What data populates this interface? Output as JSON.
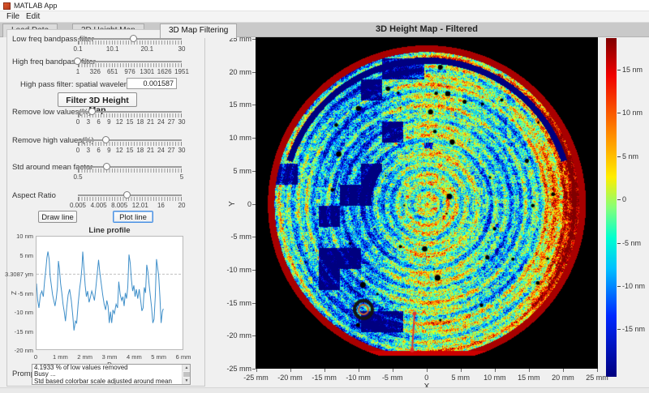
{
  "window": {
    "title": "MATLAB App",
    "menu": [
      "File",
      "Edit"
    ]
  },
  "tabs": [
    {
      "label": "Load Data",
      "active": false
    },
    {
      "label": "3D Height Map",
      "active": false
    },
    {
      "label": "3D Map Filtering",
      "active": true
    }
  ],
  "panel": {
    "sliders": [
      {
        "label": "Low freq bandpass filter",
        "ticks": [
          "0.1",
          "10.1",
          "20.1",
          "30"
        ],
        "percent": 54
      },
      {
        "label": "High freq bandpass filter",
        "ticks": [
          "1",
          "326",
          "651",
          "976",
          "1301",
          "1626",
          "1951"
        ],
        "percent": 0
      },
      {
        "label": "Remove low values(%)",
        "ticks": [
          "0",
          "3",
          "6",
          "9",
          "12",
          "15",
          "18",
          "21",
          "24",
          "27",
          "30"
        ],
        "percent": 14
      },
      {
        "label": "Remove high values(%)",
        "ticks": [
          "0",
          "3",
          "6",
          "9",
          "12",
          "15",
          "18",
          "21",
          "24",
          "27",
          "30"
        ],
        "percent": 27
      },
      {
        "label": "Std around mean factor",
        "ticks": [
          "0.5",
          "5"
        ],
        "percent": 28
      },
      {
        "label": "Aspect Ratio",
        "ticks": [
          "0.005",
          "4.005",
          "8.005",
          "12.01",
          "16",
          "20"
        ],
        "percent": 48
      }
    ],
    "highpass": {
      "label": "High pass filter: spatial wavelength (m)",
      "value": "0.001587"
    },
    "filter_button": "Filter 3D Height Map",
    "buttons": {
      "draw": "Draw line",
      "plot": "Plot line"
    },
    "prompt_label": "Prompt",
    "prompt_lines": [
      "4.1933 % of low values removed",
      "Busy ...",
      "Std based colorbar scale adjusted around mean"
    ]
  },
  "colors": {
    "accent_blue": "#4a90e2",
    "profile_line": "#3f8fc9",
    "measure_line": "#e03131",
    "colormap": "jet"
  },
  "chart_data": [
    {
      "type": "line",
      "title": "Line profile",
      "xlabel": "D",
      "ylabel": "Z",
      "xlim": [
        0,
        6
      ],
      "ylim": [
        -20,
        10
      ],
      "x_ticks": [
        "0",
        "1 mm",
        "2 mm",
        "3 mm",
        "4 mm",
        "5 mm",
        "6 mm"
      ],
      "y_ticks": [
        "10 nm",
        "5 nm",
        "3.3087 ym",
        "-5 nm",
        "-10 nm",
        "-15 nm",
        "-20 nm"
      ],
      "grid": "dashed zero line",
      "legend": "none",
      "points": [
        [
          0,
          -2.5
        ],
        [
          0.05,
          -7
        ],
        [
          0.1,
          -9
        ],
        [
          0.16,
          -5.5
        ],
        [
          0.22,
          -4.5
        ],
        [
          0.28,
          -6
        ],
        [
          0.33,
          -2
        ],
        [
          0.38,
          1
        ],
        [
          0.43,
          4.5
        ],
        [
          0.47,
          6
        ],
        [
          0.52,
          4
        ],
        [
          0.56,
          -0.5
        ],
        [
          0.61,
          -3
        ],
        [
          0.66,
          -5.5
        ],
        [
          0.71,
          -7
        ],
        [
          0.76,
          -8.5
        ],
        [
          0.81,
          -6.5
        ],
        [
          0.86,
          -3.5
        ],
        [
          0.9,
          3.5
        ],
        [
          0.94,
          1.5
        ],
        [
          0.99,
          -2.5
        ],
        [
          1.04,
          -5
        ],
        [
          1.09,
          -8
        ],
        [
          1.14,
          -10
        ],
        [
          1.19,
          -12.5
        ],
        [
          1.24,
          -9
        ],
        [
          1.3,
          -5.5
        ],
        [
          1.36,
          -4
        ],
        [
          1.43,
          -7
        ],
        [
          1.49,
          -11
        ],
        [
          1.54,
          -15
        ],
        [
          1.6,
          -12.5
        ],
        [
          1.65,
          -13
        ],
        [
          1.71,
          -8
        ],
        [
          1.77,
          -4
        ],
        [
          1.82,
          -1.5
        ],
        [
          1.87,
          2
        ],
        [
          1.9,
          6
        ],
        [
          1.95,
          1.5
        ],
        [
          2,
          -3
        ],
        [
          2.05,
          -6
        ],
        [
          2.1,
          -4.5
        ],
        [
          2.16,
          -7.5
        ],
        [
          2.22,
          -6
        ],
        [
          2.27,
          -4.5
        ],
        [
          2.32,
          -5.5
        ],
        [
          2.38,
          -7
        ],
        [
          2.44,
          -3.5
        ],
        [
          2.5,
          0.5
        ],
        [
          2.55,
          3.8
        ],
        [
          2.6,
          0.5
        ],
        [
          2.66,
          -2.5
        ],
        [
          2.72,
          -5.5
        ],
        [
          2.78,
          -8
        ],
        [
          2.84,
          -9.5
        ],
        [
          2.89,
          -7
        ],
        [
          2.94,
          -8.5
        ],
        [
          2.99,
          -13
        ],
        [
          3.04,
          -10
        ],
        [
          3.09,
          -13
        ],
        [
          3.14,
          -9.5
        ],
        [
          3.2,
          -10.5
        ],
        [
          3.27,
          -8
        ],
        [
          3.33,
          -9
        ],
        [
          3.38,
          -2
        ],
        [
          3.44,
          -5.5
        ],
        [
          3.5,
          -7
        ],
        [
          3.55,
          -6
        ],
        [
          3.6,
          -8.5
        ],
        [
          3.65,
          -5
        ],
        [
          3.7,
          -6.5
        ],
        [
          3.75,
          -3.5
        ],
        [
          3.8,
          5.2
        ],
        [
          3.85,
          3
        ],
        [
          3.9,
          -1.5
        ],
        [
          3.95,
          -4.5
        ],
        [
          4,
          -3
        ],
        [
          4.05,
          -6
        ],
        [
          4.1,
          -4
        ],
        [
          4.16,
          -6.5
        ],
        [
          4.22,
          -4
        ],
        [
          4.28,
          -7
        ],
        [
          4.33,
          -9.8
        ],
        [
          4.38,
          -9
        ],
        [
          4.43,
          -3.5
        ],
        [
          4.48,
          -5
        ],
        [
          4.53,
          2.5
        ],
        [
          4.58,
          0.5
        ],
        [
          4.63,
          -3
        ],
        [
          4.68,
          -6
        ],
        [
          4.73,
          -9
        ],
        [
          4.78,
          -13
        ],
        [
          4.83,
          -12
        ],
        [
          4.88,
          -6
        ],
        [
          4.93,
          4
        ],
        [
          4.97,
          2
        ],
        [
          5.02,
          -0.5
        ],
        [
          5.07,
          -6
        ],
        [
          5.12,
          -13
        ],
        [
          5.17,
          -10
        ],
        [
          5.21,
          -9.2
        ]
      ]
    },
    {
      "type": "heatmap",
      "title": "3D Height Map - Filtered",
      "xlabel": "X",
      "ylabel": "Y",
      "xlim_mm": [
        -25,
        25
      ],
      "ylim_mm": [
        -25,
        25
      ],
      "x_ticks": [
        "-25 mm",
        "-20 mm",
        "-15 mm",
        "-10 mm",
        "-5 mm",
        "0",
        "5 mm",
        "10 mm",
        "15 mm",
        "20 mm",
        "25 mm"
      ],
      "y_ticks": [
        "25 mm",
        "20 mm",
        "15 mm",
        "10 mm",
        "5 mm",
        "0",
        "-5 mm",
        "-10 mm",
        "-15 mm",
        "-20 mm",
        "-25 mm"
      ],
      "colorbar_ticks": [
        "15 nm",
        "10 nm",
        "5 nm",
        "0",
        "-5 nm",
        "-10 nm",
        "-15 nm"
      ],
      "colorbar_range_nm": [
        -19,
        19
      ],
      "description": "Circular wafer height map on black background: concentric rings of blue/cyan/green with vertical yellow-green bands, dark-red rim and red crescent on right edge, black pits, flat bottom edge, red measurement line near bottom center"
    }
  ]
}
